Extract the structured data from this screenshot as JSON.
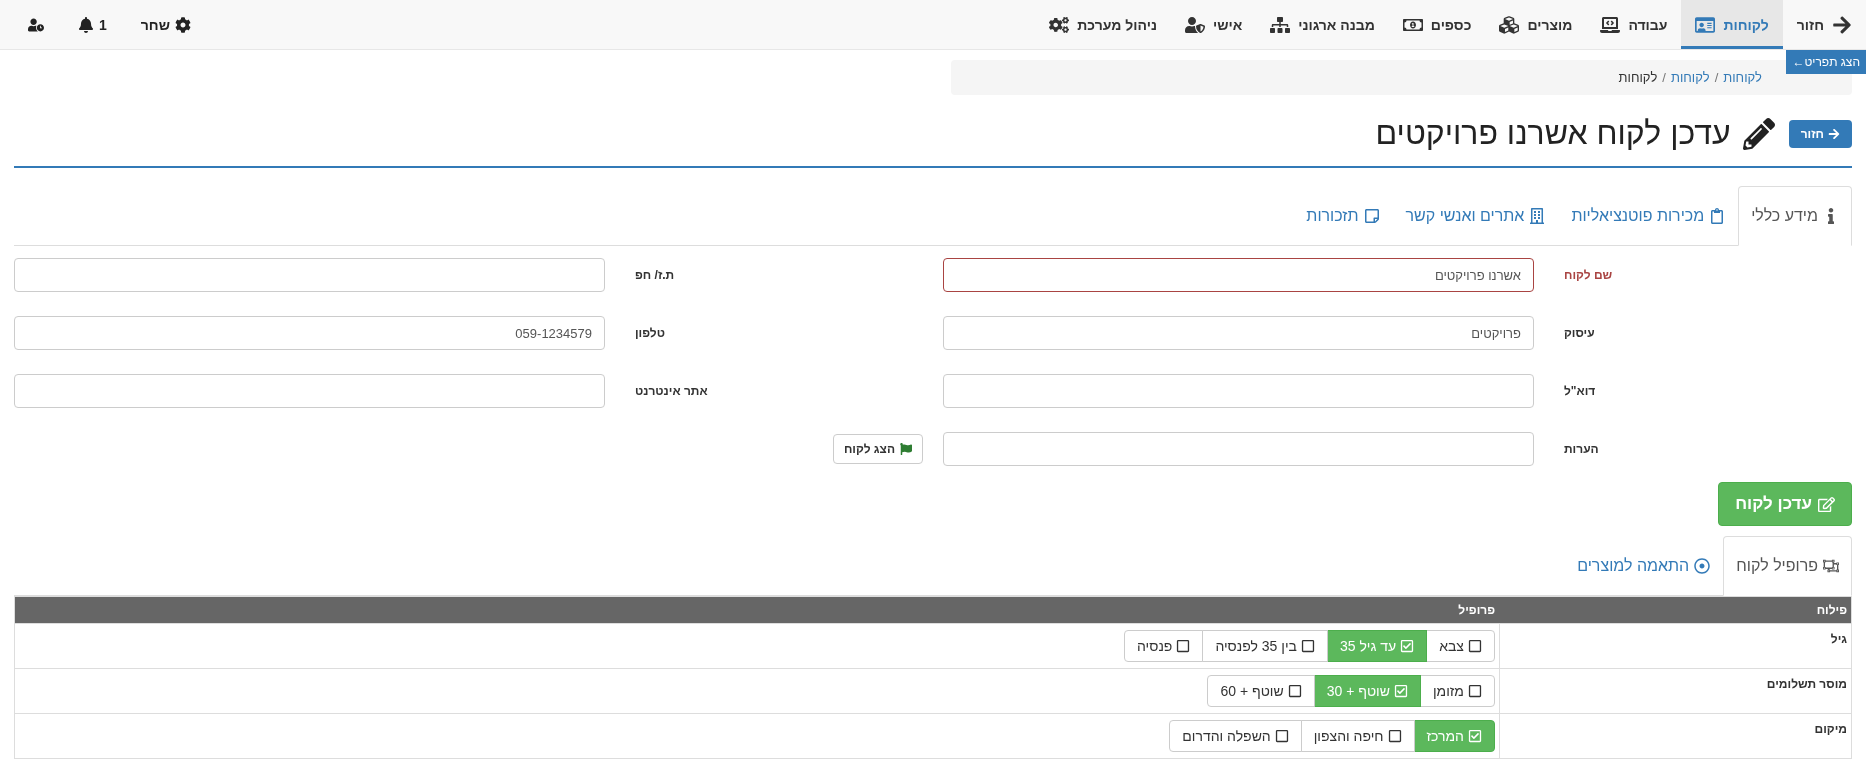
{
  "nav": {
    "items": [
      {
        "label": "חזור",
        "kind": "back",
        "selected": false
      },
      {
        "label": "לקוחות",
        "kind": "customers",
        "selected": true
      },
      {
        "label": "עבודה",
        "kind": "work",
        "selected": false
      },
      {
        "label": "מוצרים",
        "kind": "products",
        "selected": false
      },
      {
        "label": "כספים",
        "kind": "money",
        "selected": false
      },
      {
        "label": "מבנה ארגוני",
        "kind": "org",
        "selected": false
      },
      {
        "label": "אישי",
        "kind": "personal",
        "selected": false
      },
      {
        "label": "ניהול מערכת",
        "kind": "admin",
        "selected": false
      }
    ],
    "notifications": "1",
    "user": "שחר"
  },
  "menu_toggle": "הצג תפריט←",
  "breadcrumb": [
    "לקוחות",
    "לקוחות",
    "לקוחות"
  ],
  "breadcrumb_separator": "/",
  "header": {
    "back_button": "חזור",
    "title": "עדכן לקוח אשרנו פרויקטים"
  },
  "tabs": [
    {
      "label": "מידע כללי",
      "kind": "info",
      "selected": true
    },
    {
      "label": "מכירות פוטנציאליות",
      "kind": "sales",
      "selected": false
    },
    {
      "label": "אתרים ואנשי קשר",
      "kind": "sites",
      "selected": false
    },
    {
      "label": "תזכורות",
      "kind": "reminders",
      "selected": false
    }
  ],
  "form": {
    "rows": [
      {
        "fields": [
          {
            "kind": "input",
            "label": "שם לקוח",
            "value": "אשרנו פרויקטים",
            "invalid": true
          },
          {
            "kind": "input",
            "label": "ת.ז/ חפ",
            "invalid": false
          }
        ]
      },
      {
        "fields": [
          {
            "kind": "input",
            "label": "עיסוק",
            "value": "פרויקטים",
            "invalid": false
          },
          {
            "kind": "input",
            "label": "טלפון",
            "value": "059-1234579",
            "invalid": false
          }
        ]
      },
      {
        "fields": [
          {
            "kind": "input",
            "label": "דוא\"ל",
            "invalid": false
          },
          {
            "kind": "input",
            "label": "אתר אינטרנט",
            "invalid": false
          }
        ]
      },
      {
        "fields": [
          {
            "kind": "input",
            "label": "הערות",
            "invalid": false
          },
          {
            "kind": "button",
            "label": "הצג לקוח"
          }
        ]
      }
    ]
  },
  "update_button": "עדכן לקוח",
  "profile_tabs": [
    {
      "label": "פרופיל לקוח",
      "kind": "profile",
      "selected": true
    },
    {
      "label": "התאמה למוצרים",
      "kind": "match",
      "selected": false
    }
  ],
  "profile_table": {
    "columns": [
      "פילוח",
      "פרופיל"
    ],
    "rows": [
      {
        "segment": "גיל",
        "options": [
          {
            "label": "צבא",
            "selected": false
          },
          {
            "label": "עד גיל 35",
            "selected": true
          },
          {
            "label": "בין 35 לפנסיה",
            "selected": false
          },
          {
            "label": "פנסיה",
            "selected": false
          }
        ]
      },
      {
        "segment": "מוסר תשלומים",
        "options": [
          {
            "label": "מזומן",
            "selected": false
          },
          {
            "label": "שוטף + 30",
            "selected": true
          },
          {
            "label": "שוטף + 60",
            "selected": false
          }
        ]
      },
      {
        "segment": "מיקום",
        "options": [
          {
            "label": "המרכז",
            "selected": true
          },
          {
            "label": "חיפה והצפון",
            "selected": false
          },
          {
            "label": "השפלה והדרום",
            "selected": false
          }
        ]
      }
    ]
  }
}
